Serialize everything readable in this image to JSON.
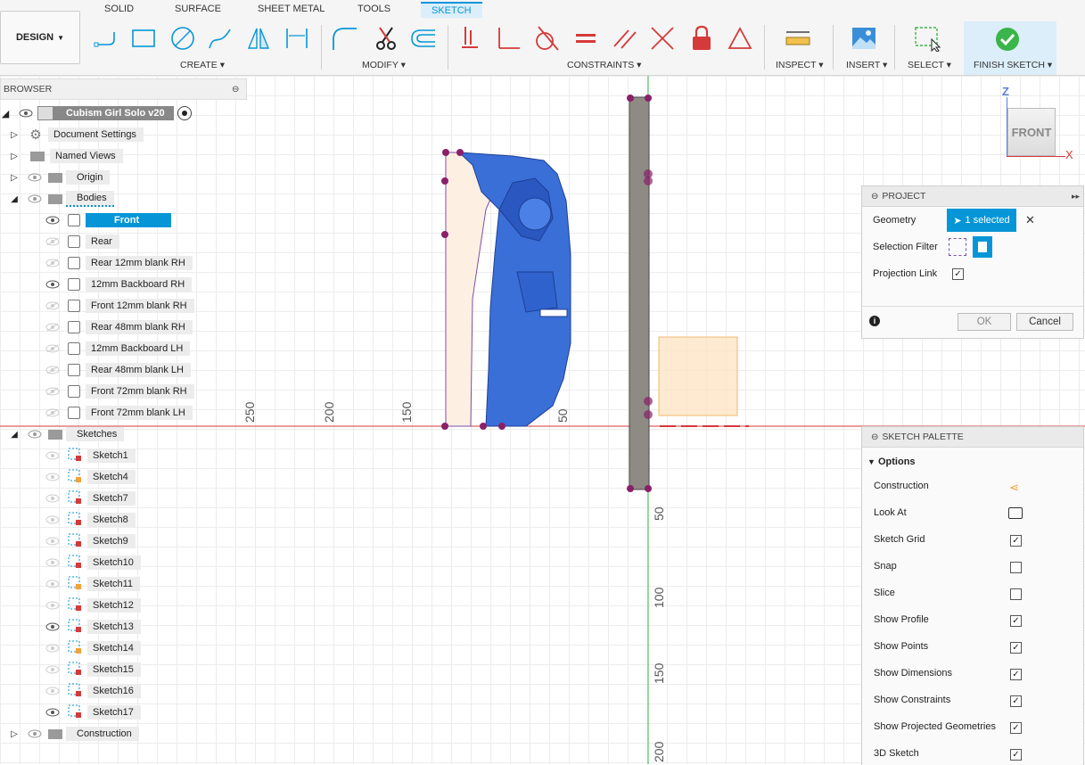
{
  "tabs": [
    "SOLID",
    "SURFACE",
    "SHEET METAL",
    "TOOLS",
    "SKETCH"
  ],
  "design_label": "DESIGN",
  "groups": {
    "create": "CREATE",
    "modify": "MODIFY",
    "constraints": "CONSTRAINTS",
    "inspect": "INSPECT",
    "insert": "INSERT",
    "select": "SELECT",
    "finish": "FINISH SKETCH"
  },
  "browser": {
    "title": "BROWSER",
    "root": "Cubism Girl Solo v20",
    "items": {
      "doc_settings": "Document Settings",
      "named_views": "Named Views",
      "origin": "Origin",
      "bodies": "Bodies",
      "sketches": "Sketches",
      "construction": "Construction"
    },
    "bodies": [
      "Front",
      "Rear",
      "Rear 12mm blank RH",
      "12mm Backboard RH",
      "Front 12mm blank RH",
      "Rear 48mm blank RH",
      "12mm Backboard LH",
      "Rear 48mm blank LH",
      "Front  72mm blank RH",
      "Front  72mm blank LH"
    ],
    "sketches": [
      "Sketch1",
      "Sketch4",
      "Sketch7",
      "Sketch8",
      "Sketch9",
      "Sketch10",
      "Sketch11",
      "Sketch12",
      "Sketch13",
      "Sketch14",
      "Sketch15",
      "Sketch16",
      "Sketch17"
    ]
  },
  "project_panel": {
    "title": "PROJECT",
    "geometry_label": "Geometry",
    "selected_text": "1 selected",
    "filter_label": "Selection Filter",
    "link_label": "Projection Link",
    "ok": "OK",
    "cancel": "Cancel"
  },
  "sketch_palette": {
    "title": "SKETCH PALETTE",
    "options_label": "Options",
    "rows": [
      "Construction",
      "Look At",
      "Sketch Grid",
      "Snap",
      "Slice",
      "Show Profile",
      "Show Points",
      "Show Dimensions",
      "Show Constraints",
      "Show Projected Geometries",
      "3D Sketch"
    ],
    "checked": [
      null,
      null,
      true,
      false,
      false,
      true,
      true,
      true,
      true,
      true,
      true
    ]
  },
  "viewcube": {
    "face": "FRONT",
    "z": "Z",
    "x": "X"
  },
  "axis_labels_h": [
    "250",
    "200",
    "150",
    "50"
  ],
  "axis_labels_v": [
    "50",
    "100",
    "150",
    "200"
  ],
  "colors": {
    "accent": "#0696d7",
    "body_blue": "#3a6fd8",
    "sketch_point": "#8a1f6a",
    "axis_red": "#d43a3a",
    "axis_green": "#3ab54a",
    "selection_fill": "#fde5c4"
  }
}
